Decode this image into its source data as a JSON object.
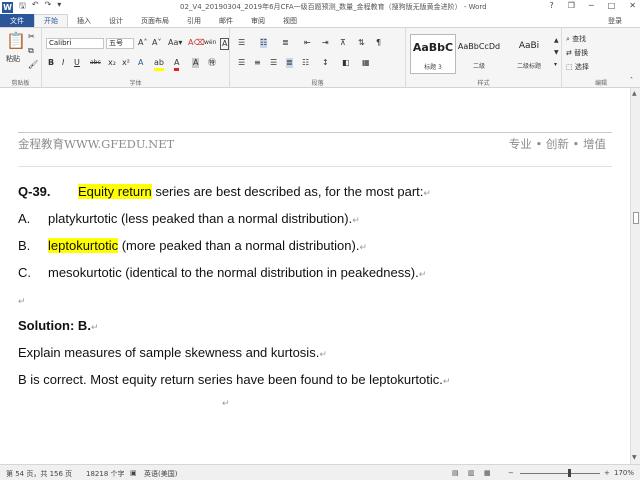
{
  "window": {
    "title": "02_V4_20190304_2019年6月CFA一级百题预测_数量_金程教育（搜狗版无版黄金进阶） - Word",
    "controls": {
      "help": "?",
      "restore": "❐",
      "minimize": "─",
      "maximize": "□",
      "close": "✕"
    }
  },
  "quick_access": {
    "save": "🖫",
    "undo": "↶",
    "redo": "↷",
    "more": "▾"
  },
  "tabs": {
    "file": "文件",
    "items": [
      "开始",
      "插入",
      "设计",
      "页面布局",
      "引用",
      "邮件",
      "审阅",
      "视图"
    ],
    "active": "开始",
    "login": "登录"
  },
  "ribbon": {
    "clipboard": {
      "paste": "粘贴",
      "label": "剪贴板"
    },
    "font": {
      "family": "Calibri",
      "size": "五号",
      "grow": "A˄",
      "shrink": "A˅",
      "case": "Aa▾",
      "clear": "A⌫",
      "wen": "wén",
      "border_char": "A",
      "bold": "B",
      "italic": "I",
      "underline": "U",
      "strike": "abc",
      "sub": "x₂",
      "sup": "x²",
      "effects": "A",
      "highlight": "ab",
      "color": "A",
      "shade": "A",
      "enclose": "㊕",
      "label": "字体"
    },
    "paragraph": {
      "label": "段落"
    },
    "styles": {
      "items": [
        {
          "sample": "AaBbC",
          "name": "标题 3"
        },
        {
          "sample": "AaBbCcDd",
          "name": "二级"
        },
        {
          "sample": "AaBi",
          "name": "二级标题"
        }
      ],
      "label": "样式"
    },
    "editing": {
      "find": "查找",
      "replace": "替换",
      "select": "选择",
      "label": "编辑"
    }
  },
  "document": {
    "header_left": "金程教育WWW.GFEDU.NET",
    "header_right": "专业 • 创新 • 增值",
    "para_mark": "↵",
    "question": {
      "label": "Q-39.",
      "highlight": "Equity return",
      "text": " series are best described as, for the most part:"
    },
    "options": [
      {
        "label": "A.",
        "pre": "",
        "highlight": "",
        "text": "platykurtotic (less peaked than a normal distribution)."
      },
      {
        "label": "B.",
        "pre": "",
        "highlight": "leptokurtotic",
        "text": " (more peaked than a normal distribution)."
      },
      {
        "label": "C.",
        "pre": "",
        "highlight": "",
        "text": "mesokurtotic (identical to the normal distribution in peakedness)."
      }
    ],
    "solution": "Solution: B.",
    "explain": "Explain measures of sample skewness and kurtosis.",
    "answer": "B is correct. Most equity return series have been found to be leptokurtotic."
  },
  "statusbar": {
    "page": "第 54 页，共 156 页",
    "words": "18218 个字",
    "lang": "英语(美国)",
    "zoom": "170%",
    "zoom_out": "−",
    "zoom_in": "+"
  },
  "colors": {
    "accent": "#2b579a",
    "highlight": "#ffff00"
  }
}
